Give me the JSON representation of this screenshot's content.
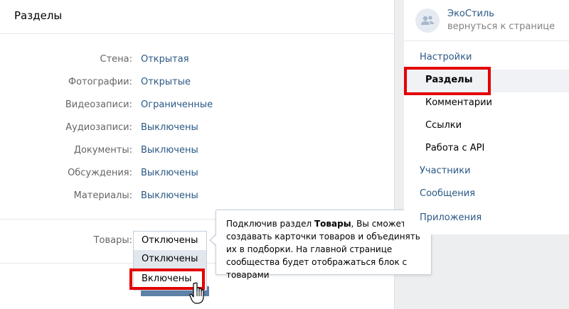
{
  "main": {
    "title": "Разделы",
    "sections": [
      {
        "label": "Стена:",
        "value": "Открытая"
      },
      {
        "label": "Фотографии:",
        "value": "Открытые"
      },
      {
        "label": "Видеозаписи:",
        "value": "Ограниченные"
      },
      {
        "label": "Аудиозаписи:",
        "value": "Выключены"
      },
      {
        "label": "Документы:",
        "value": "Выключены"
      },
      {
        "label": "Обсуждения:",
        "value": "Выключены"
      },
      {
        "label": "Материалы:",
        "value": "Выключены"
      }
    ],
    "goods": {
      "label": "Товары:",
      "selected": "Отключены",
      "options": [
        "Отключены",
        "Включены"
      ]
    }
  },
  "tooltip": {
    "text_before": "Подключив раздел ",
    "bold": "Товары",
    "text_after": ", Вы сможете создавать карточки товаров и объединять их в подборки. На главной странице сообщества будет отображаться блок с товарами"
  },
  "sidebar": {
    "group_name": "ЭкоСтиль",
    "back_link": "вернуться к странице",
    "items": [
      {
        "label": "Настройки"
      },
      {
        "label": "Разделы"
      },
      {
        "label": "Комментарии"
      },
      {
        "label": "Ссылки"
      },
      {
        "label": "Работа с API"
      },
      {
        "label": "Участники"
      },
      {
        "label": "Сообщения"
      },
      {
        "label": "Приложения"
      }
    ]
  },
  "colors": {
    "link": "#2a5885",
    "highlight": "#e30000",
    "button": "#5e81a8"
  }
}
